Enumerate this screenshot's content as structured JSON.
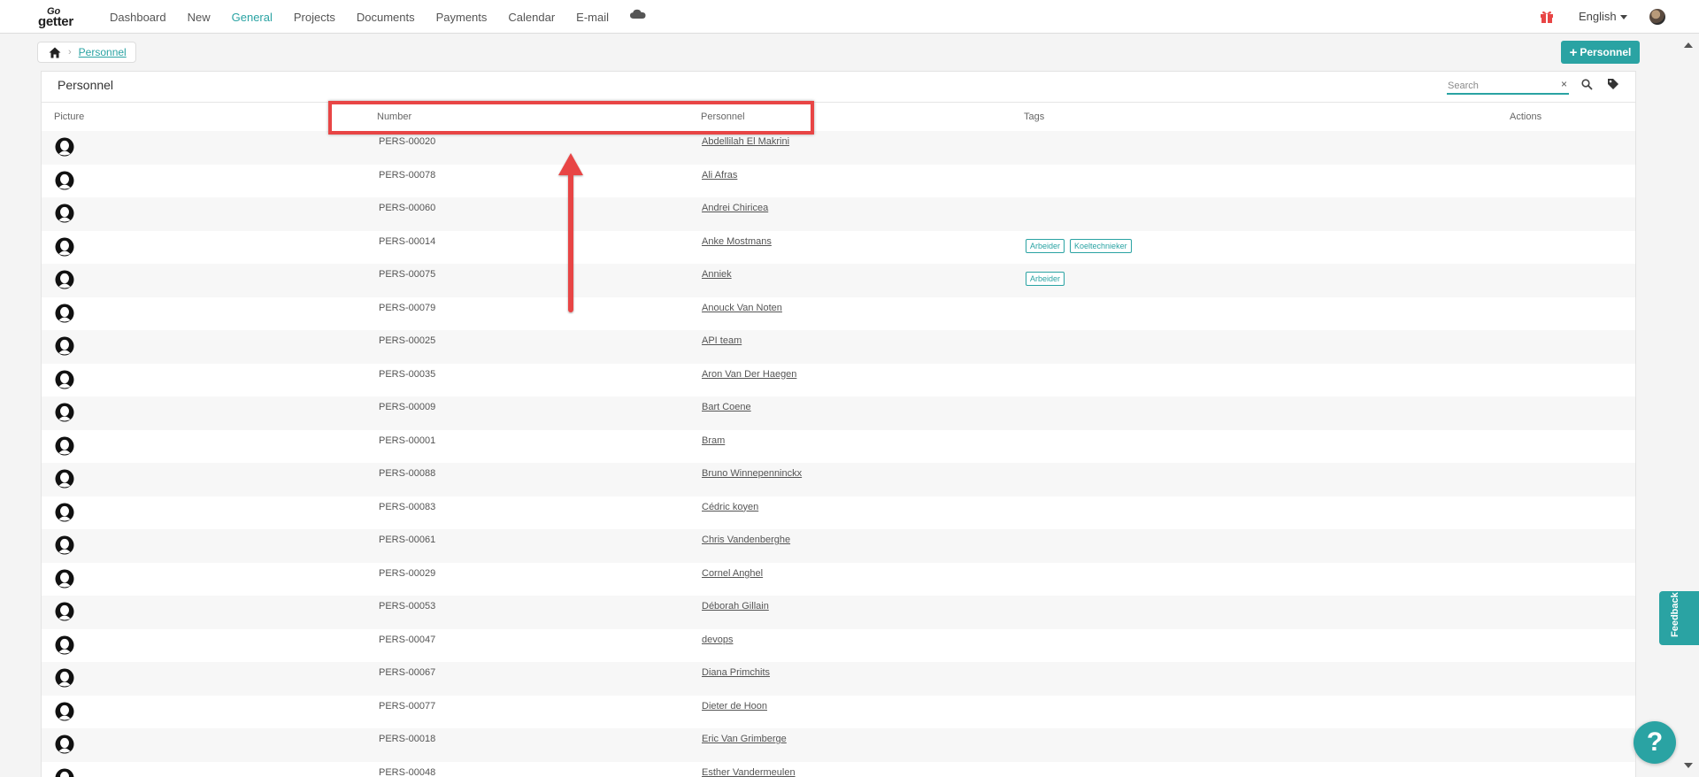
{
  "nav": {
    "logo_top": "Go",
    "logo_bottom": "getter",
    "items": [
      {
        "label": "Dashboard",
        "active": false
      },
      {
        "label": "New",
        "active": false
      },
      {
        "label": "General",
        "active": true
      },
      {
        "label": "Projects",
        "active": false
      },
      {
        "label": "Documents",
        "active": false
      },
      {
        "label": "Payments",
        "active": false
      },
      {
        "label": "Calendar",
        "active": false
      },
      {
        "label": "E-mail",
        "active": false
      }
    ],
    "language": "English"
  },
  "breadcrumb": {
    "current": "Personnel"
  },
  "add_button": "Personnel",
  "card": {
    "title": "Personnel",
    "search_placeholder": "Search",
    "clear": "×"
  },
  "table": {
    "headers": {
      "picture": "Picture",
      "number": "Number",
      "personnel": "Personnel",
      "tags": "Tags",
      "actions": "Actions"
    },
    "rows": [
      {
        "number": "PERS-00020",
        "name": "Abdellilah El Makrini",
        "tags": []
      },
      {
        "number": "PERS-00078",
        "name": "Ali Afras",
        "tags": []
      },
      {
        "number": "PERS-00060",
        "name": "Andrei Chiricea",
        "tags": []
      },
      {
        "number": "PERS-00014",
        "name": "Anke Mostmans",
        "tags": [
          "Arbeider",
          "Koeltechnieker"
        ]
      },
      {
        "number": "PERS-00075",
        "name": "Anniek",
        "tags": [
          "Arbeider"
        ]
      },
      {
        "number": "PERS-00079",
        "name": "Anouck Van Noten",
        "tags": []
      },
      {
        "number": "PERS-00025",
        "name": "API team",
        "tags": []
      },
      {
        "number": "PERS-00035",
        "name": "Aron Van Der Haegen",
        "tags": []
      },
      {
        "number": "PERS-00009",
        "name": "Bart Coene",
        "tags": []
      },
      {
        "number": "PERS-00001",
        "name": "Bram",
        "tags": []
      },
      {
        "number": "PERS-00088",
        "name": "Bruno Winnepenninckx",
        "tags": []
      },
      {
        "number": "PERS-00083",
        "name": "Cédric koyen",
        "tags": []
      },
      {
        "number": "PERS-00061",
        "name": "Chris Vandenberghe",
        "tags": []
      },
      {
        "number": "PERS-00029",
        "name": "Cornel Anghel",
        "tags": []
      },
      {
        "number": "PERS-00053",
        "name": "Déborah Gillain",
        "tags": []
      },
      {
        "number": "PERS-00047",
        "name": "devops",
        "tags": []
      },
      {
        "number": "PERS-00067",
        "name": "Diana Primchits",
        "tags": []
      },
      {
        "number": "PERS-00077",
        "name": "Dieter de Hoon",
        "tags": []
      },
      {
        "number": "PERS-00018",
        "name": "Eric Van Grimberge",
        "tags": []
      },
      {
        "number": "PERS-00048",
        "name": "Esther Vandermeulen",
        "tags": []
      }
    ]
  },
  "feedback": "Feedback",
  "help": "?",
  "colors": {
    "accent": "#2aa3a3",
    "annotation": "#e84545"
  }
}
